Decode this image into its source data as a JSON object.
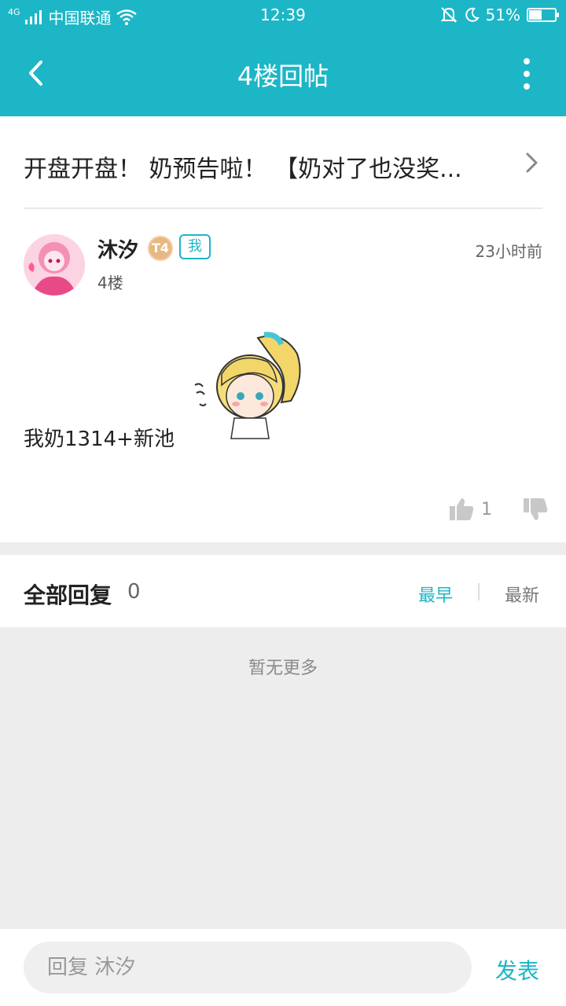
{
  "status_bar": {
    "network": "4G",
    "carrier": "中国联通",
    "time": "12:39",
    "battery": "51%",
    "battery_level": 0.51
  },
  "nav": {
    "title": "4楼回帖",
    "back_icon": "chevron-left-icon",
    "more_icon": "more-vertical-icon"
  },
  "thread": {
    "title": "开盘开盘！ 奶预告啦！ 【奶对了也没奖..."
  },
  "post": {
    "username": "沐汐",
    "level_badge": "T4",
    "me_tag": "我",
    "floor": "4楼",
    "time": "23小时前",
    "content": "我奶1314+新池",
    "likes": "1"
  },
  "replies": {
    "heading": "全部回复",
    "count": "0",
    "sort_earliest": "最早",
    "sort_newest": "最新",
    "empty_text": "暂无更多"
  },
  "bottom_bar": {
    "placeholder": "回复 沐汐",
    "send_label": "发表"
  },
  "colors": {
    "accent": "#1db6c6",
    "background": "#ededed"
  }
}
